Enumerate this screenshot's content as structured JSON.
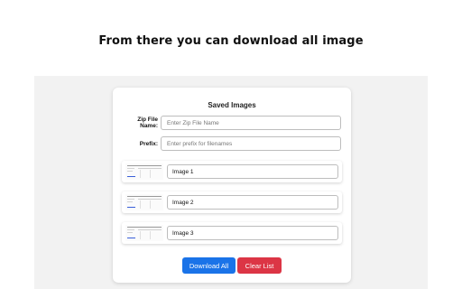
{
  "headline": "From there you can download all image",
  "panel": {
    "title": "Saved Images",
    "zip_label": "Zip File Name:",
    "zip_placeholder": "Enter Zip File Name",
    "prefix_label": "Prefix:",
    "prefix_placeholder": "Enter prefix for filenames",
    "images": [
      {
        "name": "Image 1"
      },
      {
        "name": "Image 2"
      },
      {
        "name": "Image 3"
      }
    ],
    "download_label": "Download All",
    "clear_label": "Clear List"
  },
  "colors": {
    "download_button": "#1a73e8",
    "clear_button": "#dc3545",
    "page_background": "#f2f2f2"
  }
}
